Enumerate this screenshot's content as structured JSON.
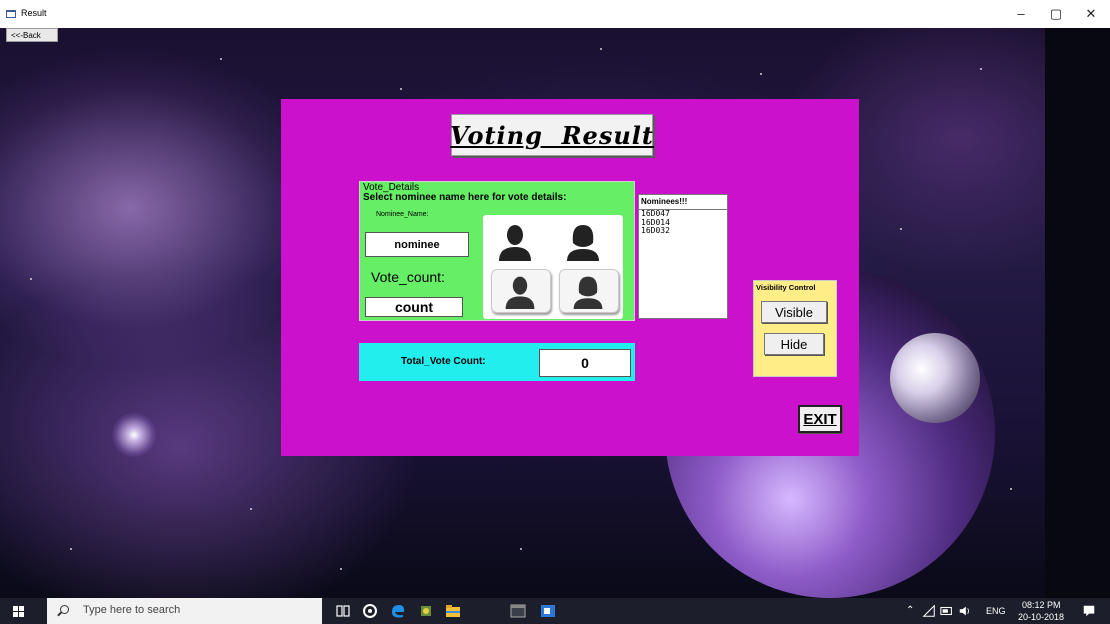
{
  "window": {
    "title": "Result",
    "back_label": "<<-Back",
    "controls": {
      "minimize": "–",
      "maximize": "▢",
      "close": "✕"
    }
  },
  "form": {
    "heading": "Voting  Result",
    "vote_details": {
      "group_title": "Vote_Details",
      "hint": "Select nominee name here for vote details:",
      "nominee_label": "Nominee_Name:",
      "nominee_value": "nominee",
      "vote_count_label": "Vote_count:",
      "vote_count_value": "count"
    },
    "nominees_list": {
      "header": "Nominees!!!",
      "items": [
        "16D047",
        "16D014",
        "16D032"
      ]
    },
    "total": {
      "label": "Total_Vote Count:",
      "value": "0"
    },
    "visibility": {
      "title": "Visibility Control",
      "visible_label": "Visible",
      "hide_label": "Hide"
    },
    "exit_label": "EXIT",
    "colors": {
      "panel": "#cc11cc",
      "vote_group": "#66ee66",
      "total_strip": "#22eeee",
      "visibility_group": "#ffee88"
    }
  },
  "taskbar": {
    "search_placeholder": "Type here to search",
    "language": "ENG",
    "time": "08:12 PM",
    "date": "20-10-2018",
    "icons": [
      "windows-start-icon",
      "task-view-icon",
      "cortana-icon",
      "edge-icon",
      "app-icon",
      "file-explorer-icon",
      "terminal-icon",
      "app-window-icon"
    ]
  }
}
